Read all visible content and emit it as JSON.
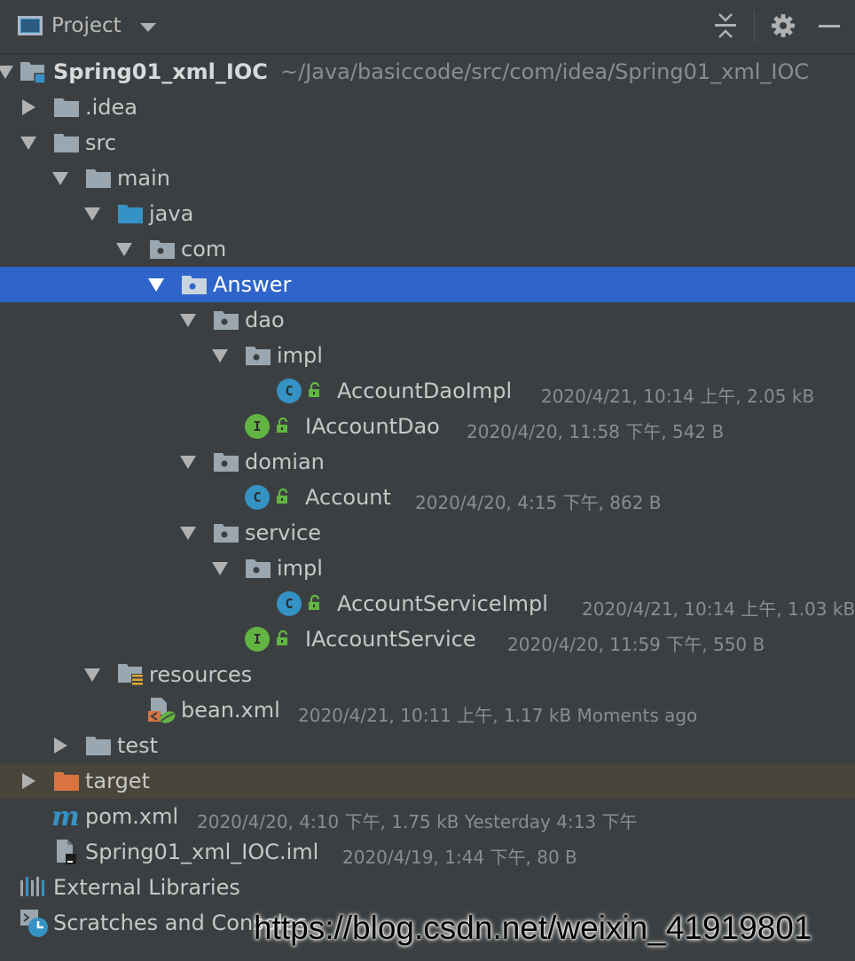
{
  "toolwindow": {
    "title": "Project"
  },
  "tree": {
    "root": {
      "name": "Spring01_xml_IOC",
      "path": "~/Java/basiccode/src/com/idea/Spring01_xml_IOC"
    },
    "idea": {
      "name": ".idea"
    },
    "src": {
      "name": "src"
    },
    "main": {
      "name": "main"
    },
    "java": {
      "name": "java"
    },
    "com": {
      "name": "com"
    },
    "answer": {
      "name": "Answer"
    },
    "dao": {
      "name": "dao"
    },
    "dao_impl": {
      "name": "impl"
    },
    "account_dao_impl": {
      "badge": "C",
      "name": "AccountDaoImpl",
      "meta": "2020/4/21, 10:14 上午, 2.05 kB"
    },
    "iaccount_dao": {
      "badge": "I",
      "name": "IAccountDao",
      "meta": "2020/4/20, 11:58 下午, 542 B"
    },
    "domian": {
      "name": "domian"
    },
    "account": {
      "badge": "C",
      "name": "Account",
      "meta": "2020/4/20, 4:15 下午, 862 B"
    },
    "service": {
      "name": "service"
    },
    "service_impl": {
      "name": "impl"
    },
    "account_service_impl": {
      "badge": "C",
      "name": "AccountServiceImpl",
      "meta": "2020/4/21, 10:14 上午, 1.03 kB"
    },
    "iaccount_service": {
      "badge": "I",
      "name": "IAccountService",
      "meta": "2020/4/20, 11:59 下午, 550 B"
    },
    "resources": {
      "name": "resources"
    },
    "bean_xml": {
      "name": "bean.xml",
      "meta": "2020/4/21, 10:11 上午, 1.17 kB Moments ago"
    },
    "test": {
      "name": "test"
    },
    "target": {
      "name": "target"
    },
    "pom_xml": {
      "name": "pom.xml",
      "meta": "2020/4/20, 4:10 下午, 1.75 kB Yesterday 4:13 下午"
    },
    "iml": {
      "name": "Spring01_xml_IOC.iml",
      "meta": "2020/4/19, 1:44 下午, 80 B"
    },
    "external_libraries": {
      "name": "External Libraries"
    },
    "scratches": {
      "name": "Scratches and Consoles"
    }
  },
  "watermark": "https://blog.csdn.net/weixin_41919801",
  "colors": {
    "background": "#3c3f41",
    "selection": "#2f65ca",
    "excluded_row": "#4a453a",
    "folder": "#9aa7b0",
    "source_folder": "#3592c4",
    "excluded_folder": "#d9733f",
    "class_badge": "#3592c4",
    "interface_badge": "#62b543"
  },
  "icons": [
    "project-view-icon",
    "dropdown-icon",
    "collapse-all-icon",
    "gear-icon",
    "hide-icon",
    "folder-icon",
    "package-icon",
    "class-icon",
    "interface-icon",
    "lock-icon",
    "xml-icon",
    "maven-icon",
    "iml-file-icon",
    "libraries-icon",
    "scratches-icon"
  ]
}
